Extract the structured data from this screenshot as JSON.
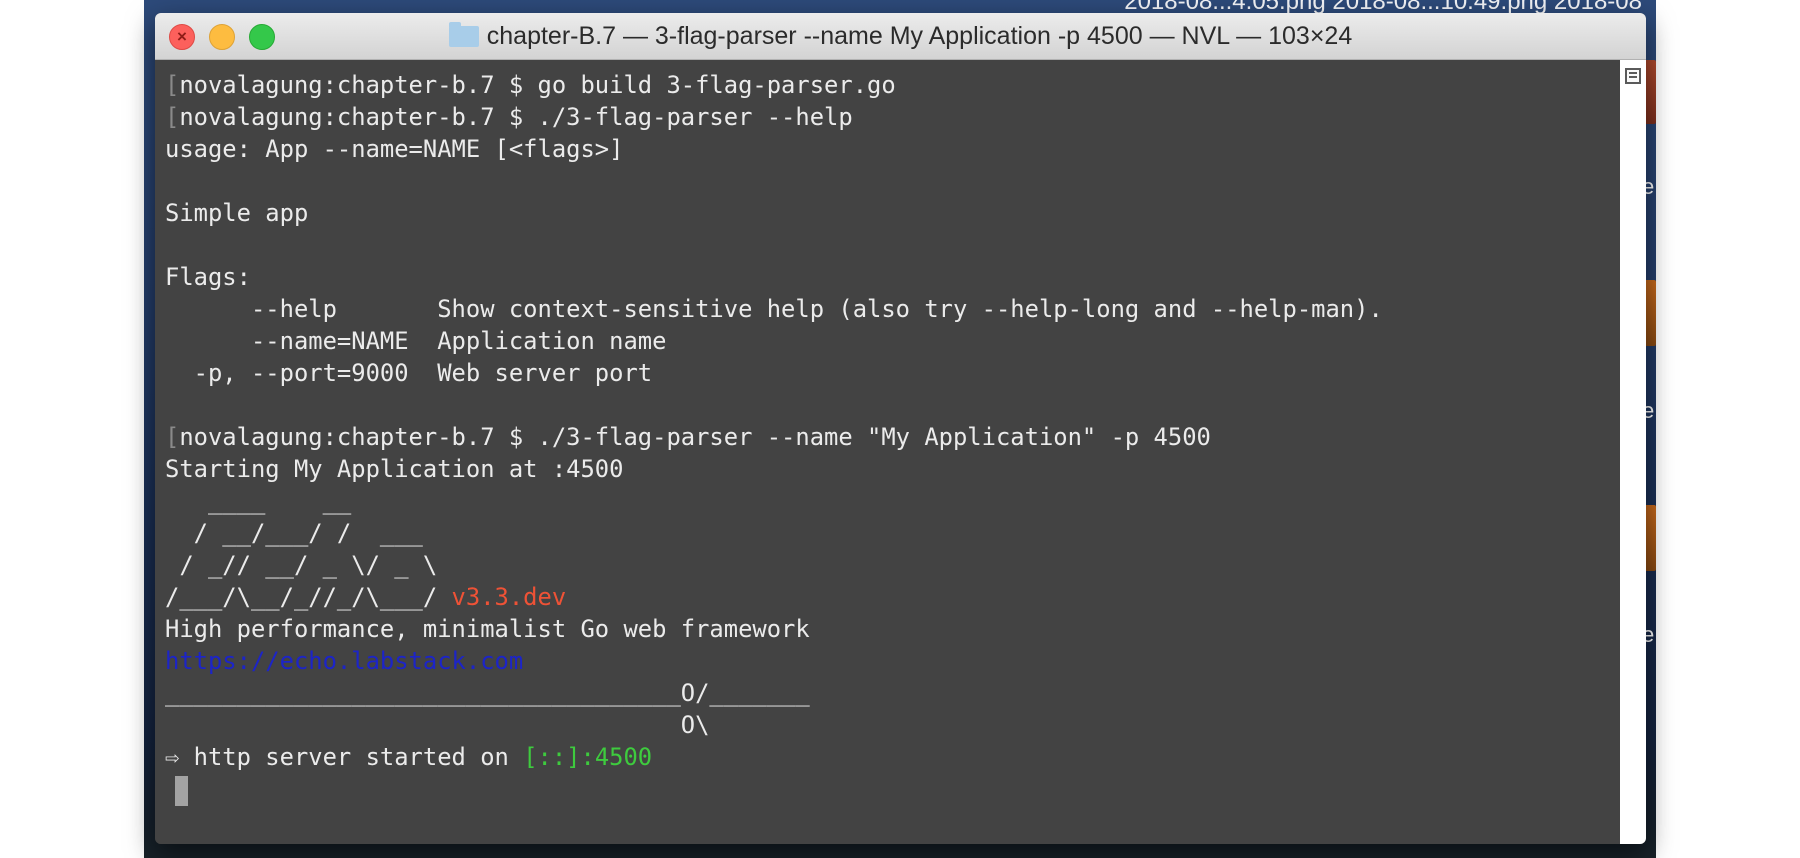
{
  "desktop": {
    "files_text": "2018-08...4.05.png   2018-08...10.49.png   2018-08",
    "side_labels": [
      "e",
      "e",
      "e"
    ]
  },
  "window": {
    "title": "chapter-B.7 — 3-flag-parser --name My Application -p 4500 — NVL — 103×24",
    "close_glyph": "×"
  },
  "terminal": {
    "line1": "novalagung:chapter-b.7 $ go build 3-flag-parser.go",
    "line2": "novalagung:chapter-b.7 $ ./3-flag-parser --help",
    "line3": "usage: App --name=NAME [<flags>]",
    "line4": "",
    "line5": "Simple app",
    "line6": "",
    "line7": "Flags:",
    "line8": "      --help       Show context-sensitive help (also try --help-long and --help-man).",
    "line9": "      --name=NAME  Application name",
    "line10": "  -p, --port=9000  Web server port",
    "line11": "",
    "line12": "novalagung:chapter-b.7 $ ./3-flag-parser --name \"My Application\" -p 4500",
    "line13": "Starting My Application at :4500",
    "line14": "   ____    __",
    "line15": "  / __/___/ /  ___",
    "line16": " / _// __/ _ \\/ _ \\",
    "line17": "/___/\\__/_//_/\\___/ ",
    "version": "v3.3.dev",
    "line18": "High performance, minimalist Go web framework",
    "line19": "https://echo.labstack.com",
    "line20": "____________________________________O/_______",
    "line21": "                                    O\\",
    "line22_prefix": "⇨ http server started on ",
    "line22_addr": "[::]:4500",
    "open_mark": "[",
    "close_mark": "]"
  },
  "colors": {
    "terminal_bg": "#434343",
    "text": "#ebebeb",
    "version": "#ef5236",
    "link": "#1c24c8",
    "address": "#3ecb3e"
  }
}
